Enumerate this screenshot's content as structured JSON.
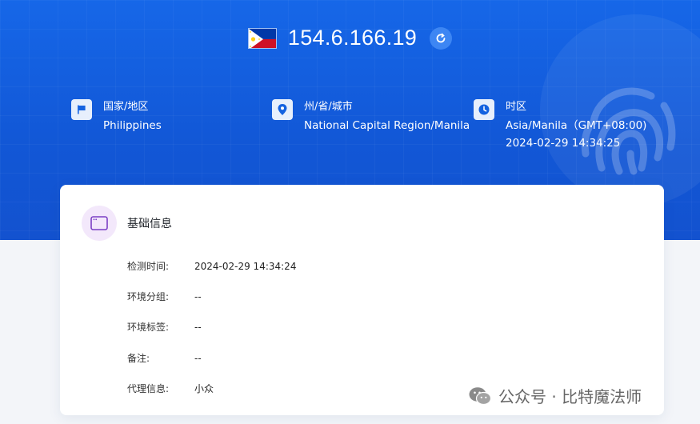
{
  "header": {
    "ip": "154.6.166.19",
    "flag": "philippines-flag",
    "refresh_icon": "refresh-icon"
  },
  "info": {
    "country": {
      "label": "国家/地区",
      "value": "Philippines",
      "icon": "flag-icon"
    },
    "region": {
      "label": "州/省/城市",
      "value": "National Capital Region/Manila",
      "icon": "location-pin-icon"
    },
    "timezone": {
      "label": "时区",
      "value": "Asia/Manila（GMT+08:00)",
      "time": "2024-02-29 14:34:25",
      "icon": "clock-icon"
    }
  },
  "basic_info": {
    "title": "基础信息",
    "fields": [
      {
        "label": "检测时间:",
        "value": "2024-02-29 14:34:24"
      },
      {
        "label": "环境分组:",
        "value": "--"
      },
      {
        "label": "环境标签:",
        "value": "--"
      },
      {
        "label": "备注:",
        "value": "--"
      },
      {
        "label": "代理信息:",
        "value": "小众"
      }
    ]
  },
  "watermark": {
    "text": "公众号 · 比特魔法师",
    "icon": "wechat-icon"
  },
  "colors": {
    "hero_blue": "#1462e0",
    "accent_purple": "#7b3fc4",
    "card_icon_bg": "#f3e8fb"
  }
}
